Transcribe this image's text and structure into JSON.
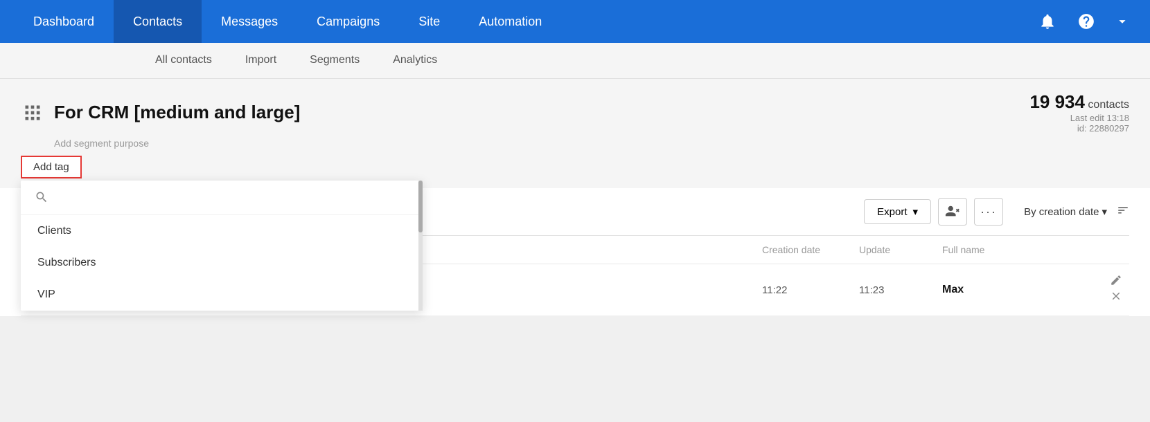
{
  "nav": {
    "items": [
      {
        "label": "Dashboard",
        "active": false
      },
      {
        "label": "Contacts",
        "active": true
      },
      {
        "label": "Messages",
        "active": false
      },
      {
        "label": "Campaigns",
        "active": false
      },
      {
        "label": "Site",
        "active": false
      },
      {
        "label": "Automation",
        "active": false
      }
    ],
    "icons": {
      "bell": "🔔",
      "help": "?"
    }
  },
  "sub_nav": {
    "items": [
      {
        "label": "All contacts",
        "active": false
      },
      {
        "label": "Import",
        "active": false
      },
      {
        "label": "Segments",
        "active": false
      },
      {
        "label": "Analytics",
        "active": false
      }
    ]
  },
  "page": {
    "title": "For CRM [medium and large]",
    "contacts_count": "19 934",
    "contacts_label": " contacts",
    "last_edit": "Last edit 13:18",
    "segment_id": "id: 22880297",
    "purpose_placeholder": "Add segment purpose"
  },
  "add_tag": {
    "button_label": "Add tag",
    "search_placeholder": "",
    "tags": [
      {
        "label": "Clients"
      },
      {
        "label": "Subscribers"
      },
      {
        "label": "VIP"
      }
    ]
  },
  "toolbar": {
    "export_label": "Export",
    "sort_label": "By creation date",
    "export_chevron": "▾",
    "sort_chevron": "▾"
  },
  "table": {
    "columns": [
      {
        "label": ""
      },
      {
        "label": ""
      },
      {
        "label": "Creation date"
      },
      {
        "label": "Update"
      },
      {
        "label": "Full name"
      },
      {
        "label": ""
      }
    ],
    "rows": [
      {
        "creation_date": "11:22",
        "update": "11:23",
        "full_name": "Max"
      }
    ]
  },
  "colors": {
    "primary": "#1a6ed8",
    "tag_border": "#e53935"
  }
}
